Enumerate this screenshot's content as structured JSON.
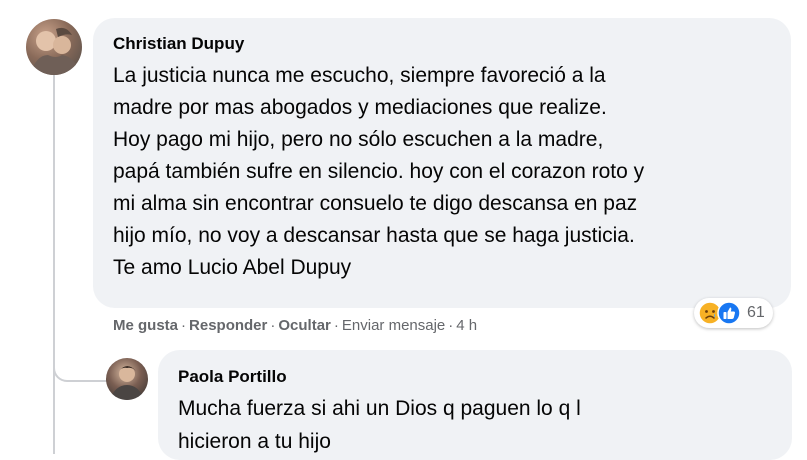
{
  "comment": {
    "author": "Christian Dupuy",
    "text": "La justicia nunca me escucho, siempre favoreció a la\nmadre por mas abogados y mediaciones que realize.\nHoy pago mi hijo, pero no sólo escuchen a la madre,\npapá también sufre en silencio. hoy con el corazon roto y\nmi alma sin encontrar consuelo te digo descansa en paz\nhijo mío, no voy a descansar hasta que se haga justicia.\nTe amo Lucio Abel Dupuy",
    "actions": {
      "like": "Me gusta",
      "reply": "Responder",
      "hide": "Ocultar",
      "send_message": "Enviar mensaje",
      "time": "4 h",
      "separator": "·"
    },
    "reactions": {
      "icons": [
        "sad-reaction-icon",
        "like-reaction-icon"
      ],
      "count": "61"
    }
  },
  "reply": {
    "author": "Paola Portillo",
    "text": "Mucha fuerza si ahi un Dios q paguen lo q l\nhicieron a tu hijo"
  },
  "colors": {
    "bubble": "#f0f2f5",
    "secondary_text": "#65676b",
    "like_blue": "#1877f2",
    "sad_yellow": "#f7b125"
  }
}
